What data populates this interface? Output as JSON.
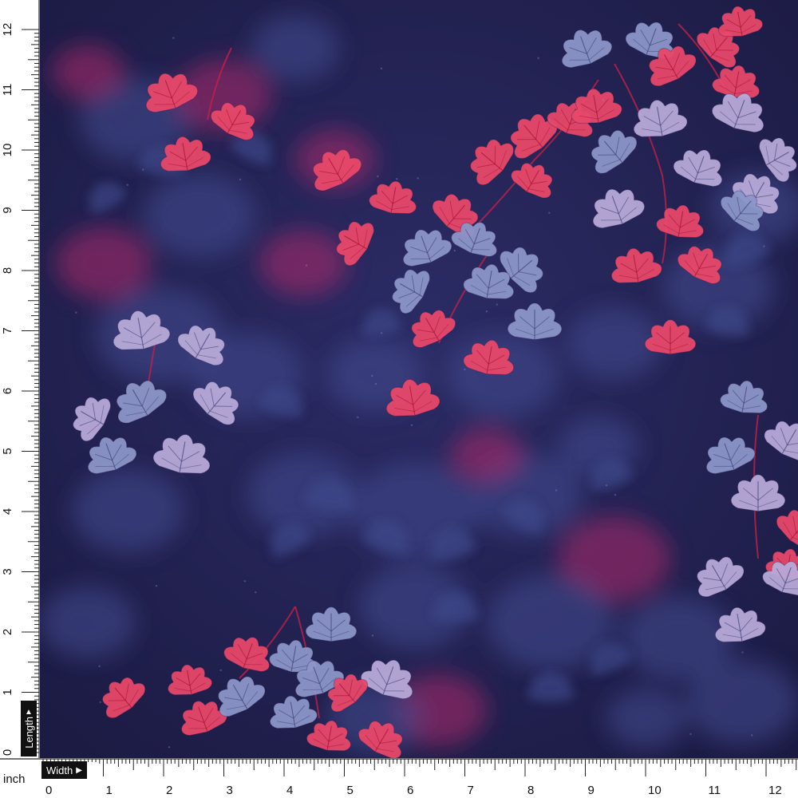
{
  "rulers": {
    "unit": "inch",
    "length_label": "Length",
    "width_label": "Width",
    "vertical_numbers": [
      "0",
      "1",
      "2",
      "3",
      "4",
      "5",
      "6",
      "7",
      "8",
      "9",
      "10",
      "11",
      "12"
    ],
    "horizontal_numbers": [
      "0",
      "1",
      "2",
      "3",
      "4",
      "5",
      "6",
      "7",
      "8",
      "9",
      "10",
      "11",
      "12"
    ]
  },
  "fabric": {
    "background_color": "#232250",
    "leaf_colors": {
      "pink": "#e8486a",
      "blue_grey": "#8c96c8",
      "lavender": "#b8aad8",
      "blurred_blue": "#3f4a8c",
      "blurred_pink": "#b02c6a",
      "stem": "#c0204a"
    }
  }
}
